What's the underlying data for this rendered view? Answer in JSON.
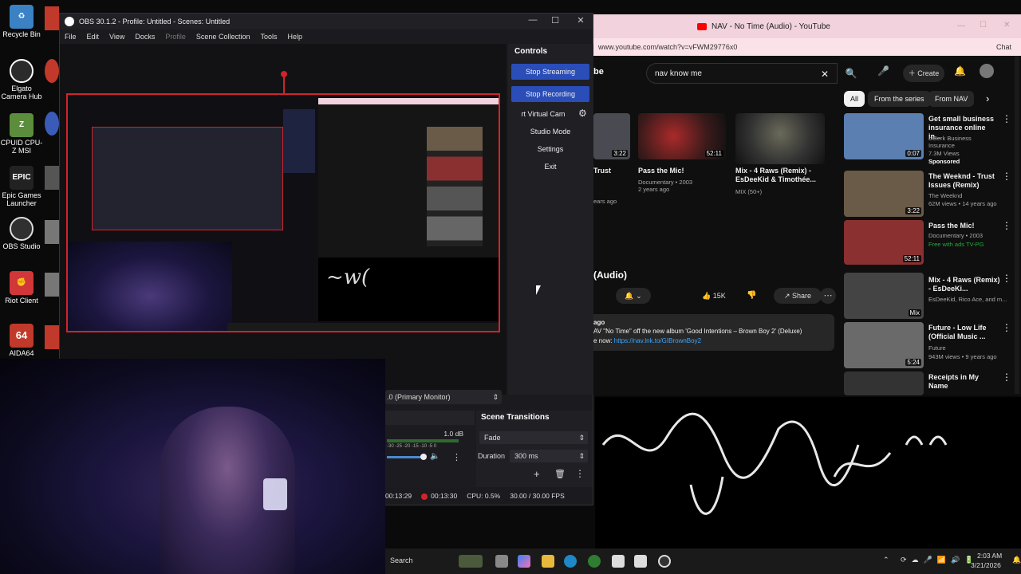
{
  "desktop_icons": [
    {
      "label": "Recycle Bin",
      "color": "#3b82c4"
    },
    {
      "label": "Elgato Camera Hub",
      "color": "#2b2b2b"
    },
    {
      "label": "CPUID CPU-Z MSI",
      "color": "#5b8d3c"
    },
    {
      "label": "Epic Games Launcher",
      "color": "#222222"
    },
    {
      "label": "OBS Studio",
      "color": "#303030"
    },
    {
      "label": "Riot Client",
      "color": "#d13639"
    },
    {
      "label": "AIDA64",
      "color": "#c0392b"
    }
  ],
  "obs": {
    "title": "OBS 30.1.2 - Profile: Untitled - Scenes: Untitled",
    "menu": [
      "File",
      "Edit",
      "View",
      "Docks",
      "Profile",
      "Scene Collection",
      "Tools",
      "Help"
    ],
    "controls": {
      "title": "Controls",
      "stop_streaming": "Stop Streaming",
      "stop_recording": "Stop Recording",
      "virtual_cam": "rt Virtual Cam",
      "studio_mode": "Studio Mode",
      "settings": "Settings",
      "exit": "Exit"
    },
    "monitor_select": ".0 (Primary Monitor)",
    "audio": {
      "db": "1.0 dB",
      "ticks": "-30  -25  -20  -15  -10  -5  0"
    },
    "scene_transitions": {
      "title": "Scene Transitions",
      "transition": "Fade",
      "duration_label": "Duration",
      "duration_value": "300 ms"
    },
    "status": {
      "stream_time": "00:13:29",
      "rec_time": "00:13:30",
      "cpu": "CPU: 0.5%",
      "fps": "30.00 / 30.00 FPS"
    }
  },
  "browser": {
    "tab_title": "NAV - No Time (Audio) - YouTube",
    "url": "www.youtube.com/watch?v=vFWM29776x0",
    "search_value": "nav know me",
    "create_label": "Create",
    "chips": [
      "All",
      "From the series",
      "From NAV"
    ],
    "main_videos": [
      {
        "title": "Trust",
        "meta": "ears ago",
        "duration": "3:22"
      },
      {
        "title": "Pass the Mic!",
        "meta": "Documentary • 2003\n2 years ago",
        "duration": "52:11"
      },
      {
        "title": "Mix - 4 Raws (Remix) - EsDeeKid & Timothée...",
        "meta": "MIX (50+)",
        "duration": ""
      }
    ],
    "video_title_partial": "(Audio)",
    "likes": "15K",
    "share_label": "Share",
    "desc_ago": "ago",
    "desc_line1": "AV \"No Time\" off the new album 'Good Intentions – Brown Boy 2' (Deluxe)",
    "desc_line2_prefix": "e now: ",
    "desc_link": "https://nav.lnk.to/GIBrownBoy2",
    "sidebar": [
      {
        "title": "Get small business insurance online in...",
        "channel": "biBerk Business Insurance",
        "views": "7.3M Views",
        "badge": "Sponsored",
        "duration": "0:07",
        "color": "#5a7fb0"
      },
      {
        "title": "The Weeknd - Trust Issues (Remix)",
        "channel": "The Weeknd",
        "views": "62M views • 14 years ago",
        "badge": "",
        "duration": "3:22",
        "color": "#6a5a48"
      },
      {
        "title": "Pass the Mic!",
        "channel": "Documentary • 2003",
        "views": "Free with ads  TV-PG",
        "badge": "",
        "duration": "52:11",
        "color": "#8a3030"
      },
      {
        "title": "Mix - 4 Raws (Remix) - EsDeeKi...",
        "channel": "EsDeeKid, Rico Ace, and m...",
        "views": "",
        "badge": "",
        "duration": "Mix",
        "color": "#444444"
      },
      {
        "title": "Future - Low Life (Official Music ...",
        "channel": "Future",
        "views": "943M views • 9 years ago",
        "badge": "",
        "duration": "5:24",
        "color": "#6a6a6a"
      },
      {
        "title": "Receipts in My Name",
        "channel": "",
        "views": "",
        "badge": "",
        "duration": "",
        "color": "#333333"
      }
    ]
  },
  "taskbar": {
    "search": "Search",
    "time": "2:03 AM",
    "date": "3/21/2026"
  }
}
